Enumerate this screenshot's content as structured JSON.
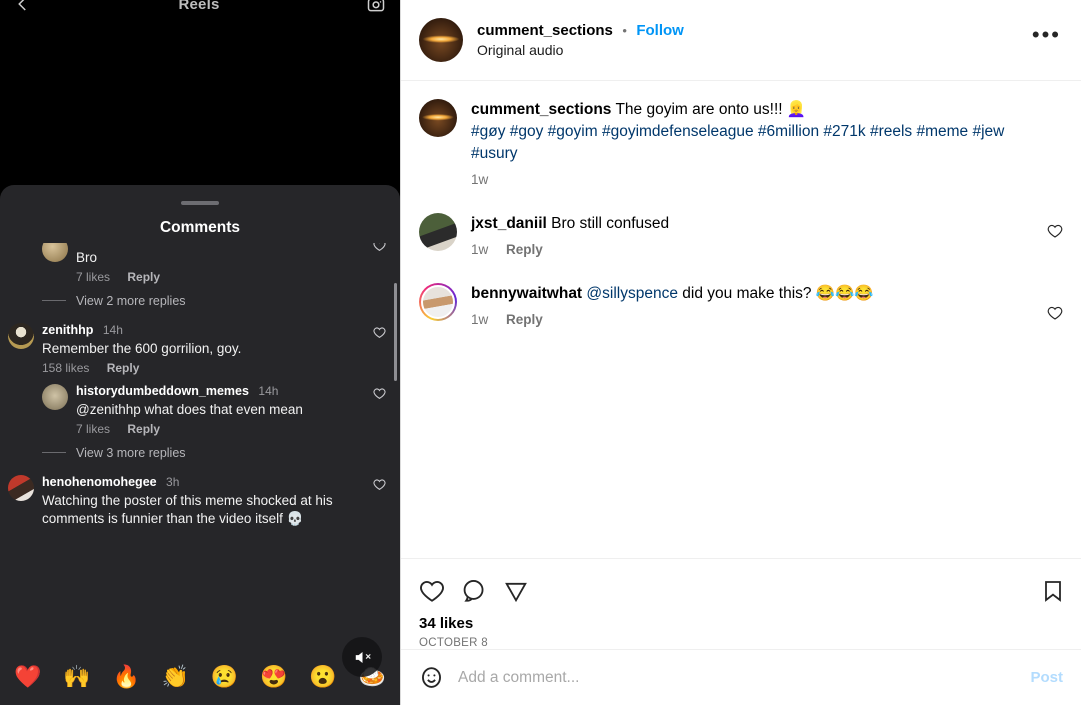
{
  "left_panel": {
    "topbar": {
      "title": "Reels",
      "back_icon": "chevron-left-icon",
      "camera_icon": "camera-icon"
    },
    "sheet_title": "Comments",
    "comments": [
      {
        "username": "",
        "time": "",
        "text": "Bro",
        "likes": "7 likes",
        "reply": "Reply",
        "indent": true,
        "clipped": true,
        "avatar": "avatar-bro"
      },
      {
        "more_replies": "View 2 more replies"
      },
      {
        "username": "zenithhp",
        "time": "14h",
        "text": "Remember the 600 gorrilion, goy.",
        "likes": "158 likes",
        "reply": "Reply",
        "indent": false,
        "avatar": "avatar-zenithhp"
      },
      {
        "username": "historydumbeddown_memes",
        "time": "14h",
        "text": "@zenithhp what does that even mean",
        "likes": "7 likes",
        "reply": "Reply",
        "indent": true,
        "avatar": "avatar-historydumbeddown"
      },
      {
        "more_replies": "View 3 more replies"
      },
      {
        "username": "henohenomohegee",
        "time": "3h",
        "text": "Watching the poster of this meme shocked at his comments is funnier than the video itself 💀",
        "likes": "",
        "reply": "",
        "indent": false,
        "avatar": "avatar-henohenomohegee"
      }
    ],
    "emoji_bar": [
      "❤️",
      "🙌",
      "🔥",
      "👏",
      "😢",
      "😍",
      "😮",
      "🍛"
    ],
    "mute_icon": "mute-icon"
  },
  "right_panel": {
    "header": {
      "username": "cumment_sections",
      "separator": "•",
      "follow_label": "Follow",
      "audio_label": "Original audio",
      "more_icon": "•••"
    },
    "caption": {
      "username": "cumment_sections",
      "text": "The goyim are onto us!!! 👱‍♀️",
      "hashtags": "#gøy #goy #goyim #goyimdefenseleague #6million #271k #reels #meme #jew #usury",
      "time": "1w"
    },
    "comments": [
      {
        "username": "jxst_daniil",
        "text": "Bro still confused",
        "mention": "",
        "time": "1w",
        "reply": "Reply",
        "has_ring": false,
        "avatar": "avatar-jxst-daniil"
      },
      {
        "username": "bennywaitwhat",
        "mention": "@sillyspence",
        "text": "did you make this? 😂😂😂",
        "time": "1w",
        "reply": "Reply",
        "has_ring": true,
        "avatar": "avatar-bennywaitwhat"
      }
    ],
    "actions": {
      "like_icon": "heart-icon",
      "comment_icon": "comment-bubble-icon",
      "share_icon": "share-paperplane-icon",
      "save_icon": "bookmark-icon",
      "likes": "34 likes",
      "date": "OCTOBER 8"
    },
    "add_comment": {
      "smiley_icon": "emoji-smiley-icon",
      "placeholder": "Add a comment...",
      "value": "",
      "post_label": "Post"
    }
  },
  "colors": {
    "follow_blue": "#0095F6",
    "hashtag_blue": "#00376B",
    "post_blue_disabled": "#B3DCFE",
    "dark_sheet": "#262629",
    "reel_black": "#000000",
    "muted_gray": "#737373"
  }
}
